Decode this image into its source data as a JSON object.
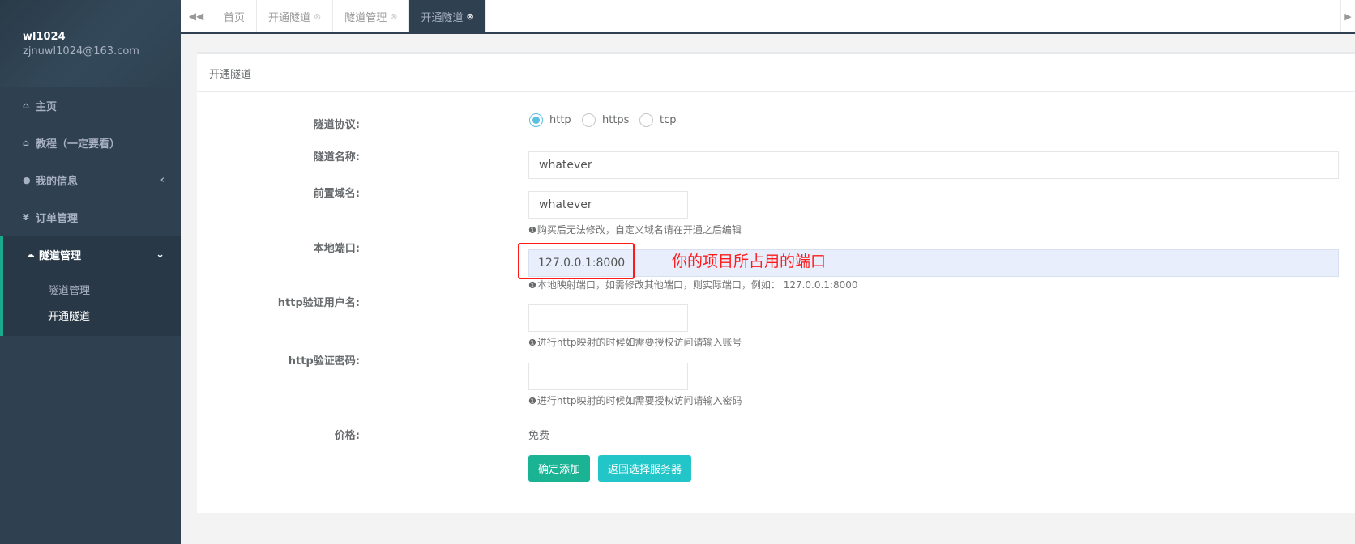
{
  "user": {
    "name": "wl1024",
    "email": "zjnuwl1024@163.com"
  },
  "nav": {
    "items": [
      {
        "label": "主页",
        "icon": "home-icon"
      },
      {
        "label": "教程（一定要看）",
        "icon": "home-icon"
      },
      {
        "label": "我的信息",
        "icon": "user-icon",
        "arrow": "‹"
      },
      {
        "label": "订单管理",
        "icon": "yen-icon"
      }
    ],
    "active": {
      "label": "隧道管理",
      "icon": "cloud-icon",
      "arrow": "⌄"
    },
    "submenu": [
      "隧道管理",
      "开通隧道"
    ]
  },
  "tabs": {
    "items": [
      {
        "label": "首页"
      },
      {
        "label": "开通隧道"
      },
      {
        "label": "隧道管理"
      },
      {
        "label": "开通隧道",
        "active": true
      }
    ]
  },
  "panel": {
    "title": "开通隧道"
  },
  "form": {
    "protocol": {
      "label": "隧道协议:",
      "options": [
        "http",
        "https",
        "tcp"
      ],
      "selected": "http"
    },
    "tunnel_name": {
      "label": "隧道名称:",
      "value": "whatever"
    },
    "prefix_domain": {
      "label": "前置域名:",
      "value": "whatever",
      "help": "购买后无法修改，自定义域名请在开通之后编辑"
    },
    "local_port": {
      "label": "本地端口:",
      "value": "127.0.0.1:8000",
      "help": "本地映射端口，如需修改其他端口，则实际端口，例如：  127.0.0.1:8000"
    },
    "http_user": {
      "label": "http验证用户名:",
      "value": "",
      "help": "进行http映射的时候如需要授权访问请输入账号"
    },
    "http_pass": {
      "label": "http验证密码:",
      "value": "",
      "help": "进行http映射的时候如需要授权访问请输入密码"
    },
    "price": {
      "label": "价格:",
      "value": "免费"
    },
    "submit_label": "确定添加",
    "back_label": "返回选择服务器"
  },
  "annotation": {
    "text": "你的项目所占用的端口",
    "color": "#ff1a1a"
  },
  "colors": {
    "sidebar": "#2f4050",
    "accent": "#1ab394",
    "info": "#23c6c8",
    "radio": "#5bc0de"
  }
}
